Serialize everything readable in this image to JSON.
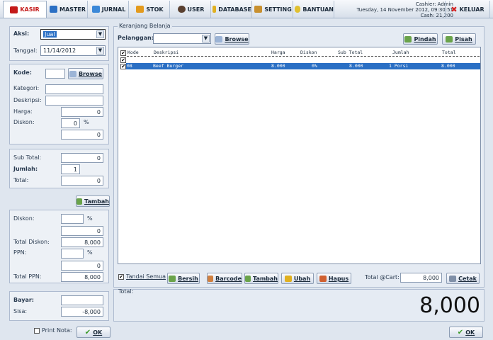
{
  "nav": {
    "items": [
      {
        "label": "KASIR",
        "color": "#c41a1a"
      },
      {
        "label": "MASTER",
        "color": "#2a6fc4"
      },
      {
        "label": "JURNAL",
        "color": "#2a6fc4"
      },
      {
        "label": "STOK",
        "color": "#e39a1d"
      },
      {
        "label": "USER",
        "color": "#5a4030"
      },
      {
        "label": "DATABASE",
        "color": "#e0b020"
      },
      {
        "label": "SETTING",
        "color": "#c89030"
      },
      {
        "label": "BANTUAN",
        "color": "#e0c030"
      }
    ],
    "keluar": "KELUAR"
  },
  "cashier": {
    "line1": "Cashier: Admin",
    "line2": "Tuesday, 14 November 2012, 09:30:51",
    "line3": "Cash: 21,200"
  },
  "left": {
    "aksi_label": "Aksi:",
    "aksi_value": "Jual",
    "tanggal_label": "Tanggal:",
    "tanggal_value": "11/14/2012",
    "kode_label": "Kode:",
    "kode_value": "",
    "browse": "Browse",
    "kategori_label": "Kategori:",
    "deskripsi_label": "Deskripsi:",
    "harga_label": "Harga:",
    "harga_value": "0",
    "diskon_label": "Diskon:",
    "diskon_value": "0",
    "diskon_unit": "%",
    "diskon_amount": "0",
    "subtotal_label": "Sub Total:",
    "subtotal_value": "0",
    "jumlah_label": "Jumlah:",
    "jumlah_value": "1",
    "total_label": "Total:",
    "total_value": "0",
    "tambah": "Tambah",
    "diskon2_label": "Diskon:",
    "diskon2_unit": "%",
    "diskon2_amount": "0",
    "totaldiskon_label": "Total Diskon:",
    "totaldiskon_value": "8,000",
    "ppn_label": "PPN:",
    "ppn_unit": "%",
    "ppn_amount": "0",
    "totalppn_label": "Total PPN:",
    "totalppn_value": "8,000",
    "bayar_label": "Bayar:",
    "bayar_value": "",
    "sisa_label": "Sisa:",
    "sisa_value": "-8,000",
    "printnota": "Print Nota:",
    "ok": "OK"
  },
  "cart": {
    "group_title": "Keranjang Belanja",
    "pelanggan_label": "Pelanggan:",
    "pelanggan_value": "",
    "browse": "Browse",
    "pindah": "Pindah",
    "pisah": "Pisah",
    "headers": [
      "Kode",
      "Deskripsi",
      "Harga",
      "Diskon",
      "Sub Total",
      "Jumlah",
      "Total"
    ],
    "rows": [
      {
        "kode": "08",
        "deskripsi": "Beef Burger",
        "harga": "8.000",
        "diskon": "0%",
        "subtotal": "8.000",
        "jumlah": "1 Porsi",
        "total": "8.000"
      }
    ],
    "tandai_semua": "Tandai Semua",
    "bersih": "Bersih",
    "barcode": "Barcode",
    "tambah": "Tambah",
    "ubah": "Ubah",
    "hapus": "Hapus",
    "total_cart_label": "Total @Cart:",
    "total_cart_value": "8,000",
    "cetak": "Cetak"
  },
  "total": {
    "label": "Total:",
    "value": "8,000"
  },
  "bottom_ok": "OK"
}
